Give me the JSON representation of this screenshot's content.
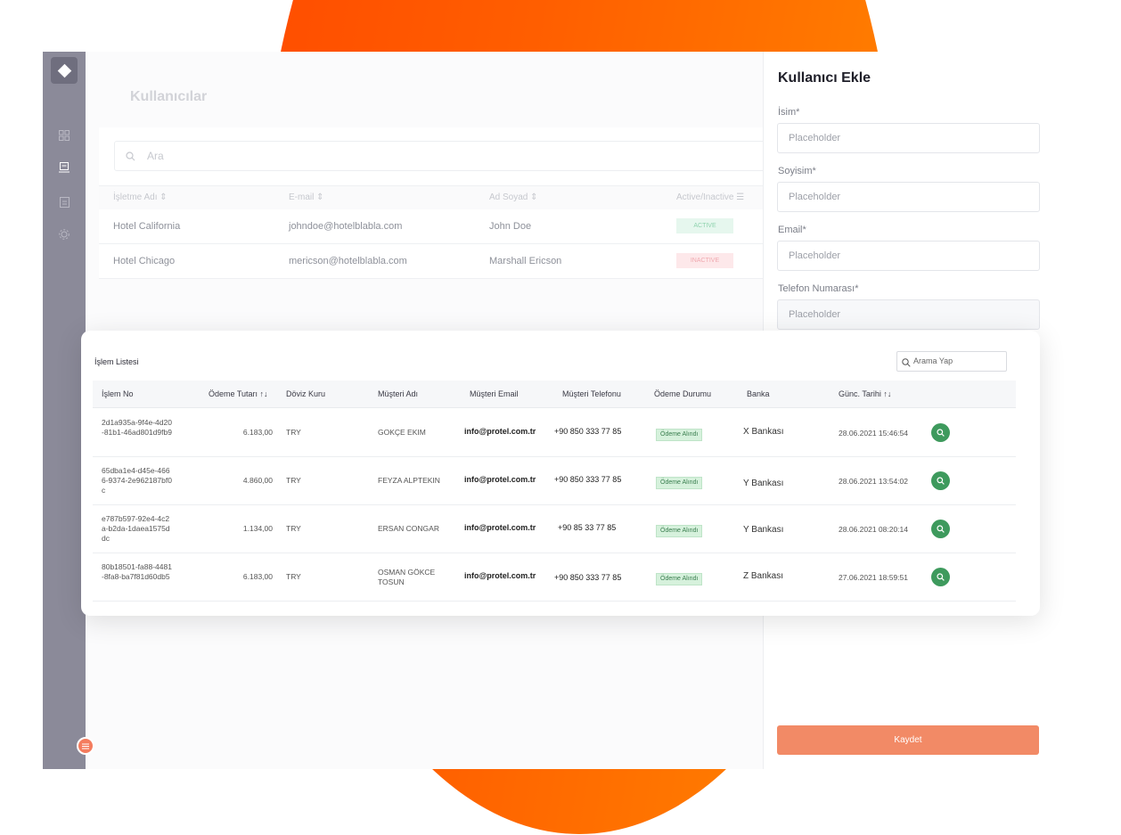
{
  "sidebar": {
    "icons": [
      "dashboard-icon",
      "users-icon",
      "document-icon",
      "settings-icon",
      "menu-icon"
    ]
  },
  "page": {
    "title": "Kullanıcılar",
    "search_placeholder": "Ara"
  },
  "users_table": {
    "columns": [
      "İşletme Adı",
      "E-mail",
      "Ad Soyad",
      "Active/Inactive"
    ],
    "rows": [
      {
        "business": "Hotel California",
        "email": "johndoe@hotelblabla.com",
        "name": "John Doe",
        "status": "ACTIVE"
      },
      {
        "business": "Hotel Chicago",
        "email": "mericson@hotelblabla.com",
        "name": "Marshall Ericson",
        "status": "INACTIVE"
      }
    ]
  },
  "add_user_panel": {
    "title": "Kullanıcı Ekle",
    "fields": [
      {
        "label": "İsim*",
        "placeholder": "Placeholder"
      },
      {
        "label": "Soyisim*",
        "placeholder": "Placeholder"
      },
      {
        "label": "Email*",
        "placeholder": "Placeholder"
      },
      {
        "label": "Telefon Numarası*",
        "placeholder": "Placeholder"
      }
    ],
    "save_label": "Kaydet"
  },
  "transactions": {
    "title": "İşlem Listesi",
    "search_placeholder": "Arama Yap",
    "columns": [
      "İşlem No",
      "Ödeme Tutarı",
      "Döviz Kuru",
      "Müşteri Adı",
      "Müşteri Email",
      "Müşteri Telefonu",
      "Ödeme Durumu",
      "Banka",
      "Günc. Tarihi"
    ],
    "sort_glyph": "↑↓",
    "rows": [
      {
        "no": "2d1a935a-9f4e-4d20-81b1-46ad801d9fb9",
        "amount": "6.183,00",
        "currency": "TRY",
        "customer": "GOKÇE EKIM",
        "email": "info@protel.com.tr",
        "phone": "+90 850 333 77 85",
        "status": "Ödeme Alındı",
        "bank": "X Bankası",
        "date": "28.06.2021 15:46:54"
      },
      {
        "no": "65dba1e4-d45e-4666-9374-2e962187bf0c",
        "amount": "4.860,00",
        "currency": "TRY",
        "customer": "FEYZA ALPTEKIN",
        "email": "info@protel.com.tr",
        "phone": "+90 850 333 77 85",
        "status": "Ödeme Alındı",
        "bank": "Y Bankası",
        "date": "28.06.2021 13:54:02"
      },
      {
        "no": "e787b597-92e4-4c2a-b2da-1daea1575ddc",
        "amount": "1.134,00",
        "currency": "TRY",
        "customer": "ERSAN CONGAR",
        "email": "info@protel.com.tr",
        "phone": "+90 85 33 77 85",
        "status": "Ödeme Alındı",
        "bank": "Y Bankası",
        "date": "28.06.2021 08:20:14"
      },
      {
        "no": "80b18501-fa88-4481-8fa8-ba7f81d60db5",
        "amount": "6.183,00",
        "currency": "TRY",
        "customer": "OSMAN GÖKCE TOSUN",
        "email": "info@protel.com.tr",
        "phone": "+90 850 333 77 85",
        "status": "Ödeme Alındı",
        "bank": "Z Bankası",
        "date": "27.06.2021 18:59:51"
      }
    ]
  },
  "colors": {
    "accent": "#f28a66",
    "sidebar": "#8b8a99",
    "success": "#3e9a5d",
    "orange_bg": "#ff5e00"
  }
}
